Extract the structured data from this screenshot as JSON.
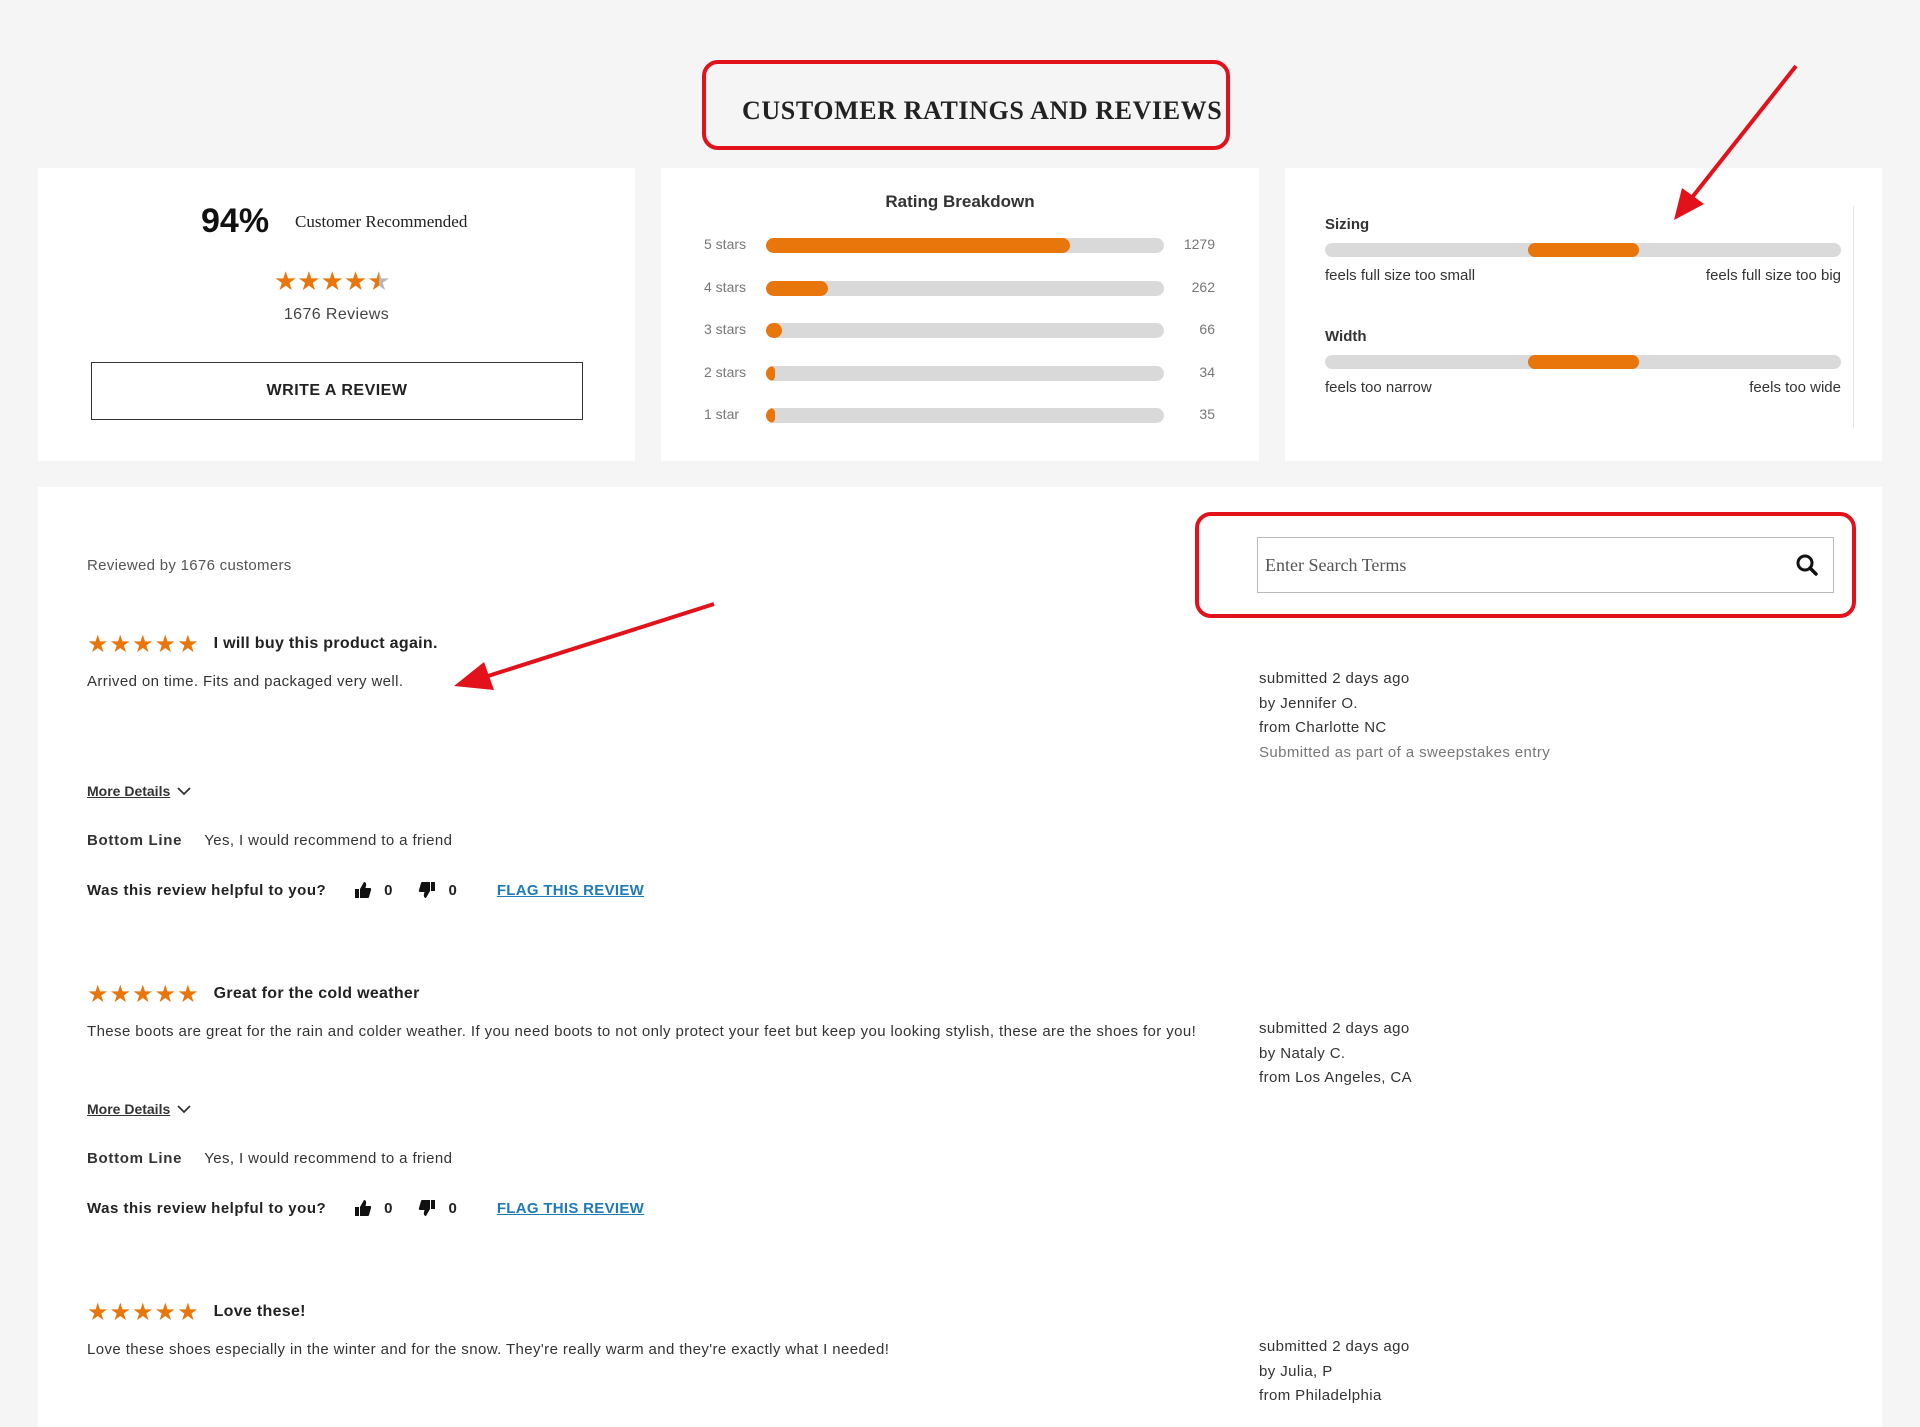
{
  "header": {
    "title": "CUSTOMER RATINGS AND REVIEWS"
  },
  "summary": {
    "recommend_percent": "94%",
    "recommend_label": "Customer Recommended",
    "stars": "★★★★",
    "half_star": "★",
    "average_rating": 4.5,
    "reviews_count_label": "1676 Reviews",
    "write_review_label": "WRITE A REVIEW"
  },
  "breakdown": {
    "title": "Rating Breakdown",
    "rows": [
      {
        "label": "5 stars",
        "count": "1279",
        "fraction": 0.763
      },
      {
        "label": "4 stars",
        "count": "262",
        "fraction": 0.156
      },
      {
        "label": "3 stars",
        "count": "66",
        "fraction": 0.039
      },
      {
        "label": "2 stars",
        "count": "34",
        "fraction": 0.02
      },
      {
        "label": "1 star",
        "count": "35",
        "fraction": 0.021
      }
    ]
  },
  "fit": {
    "sizing": {
      "title": "Sizing",
      "low_label": "feels full size too small",
      "high_label": "feels full size too big",
      "position": 0.5
    },
    "width": {
      "title": "Width",
      "low_label": "feels too narrow",
      "high_label": "feels too wide",
      "position": 0.5
    }
  },
  "reviews_panel": {
    "reviewed_by": "Reviewed by 1676 customers",
    "search_placeholder": "Enter Search Terms",
    "more_details_label": "More Details",
    "bottom_line_label": "Bottom Line",
    "helpful_question": "Was this review helpful to you?",
    "flag_label": "FLAG THIS REVIEW",
    "reviews": [
      {
        "stars": "★★★★★",
        "title": "I will buy this product again.",
        "body": "Arrived on time. Fits and packaged very well.",
        "submitted": "submitted 2 days ago",
        "author": "by Jennifer O.",
        "location": "from Charlotte NC",
        "note": "Submitted as part of a sweepstakes entry",
        "bottom_line": "Yes, I would recommend to a friend",
        "helpful_yes": "0",
        "helpful_no": "0"
      },
      {
        "stars": "★★★★★",
        "title": "Great for the cold weather",
        "body": "These boots are great for the rain and colder weather. If you need boots to not only protect your feet but keep you looking stylish, these are the shoes for you!",
        "submitted": "submitted 2 days ago",
        "author": "by Nataly C.",
        "location": "from Los Angeles, CA",
        "bottom_line": "Yes, I would recommend to a friend",
        "helpful_yes": "0",
        "helpful_no": "0"
      },
      {
        "stars": "★★★★★",
        "title": "Love these!",
        "body": "Love these shoes especially in the winter and for the snow. They're really warm and they're exactly what I needed!",
        "submitted": "submitted 2 days ago",
        "author": "by Julia, P",
        "location": "from Philadelphia"
      }
    ]
  },
  "colors": {
    "accent": "#e8760b",
    "annotation": "#e3121a",
    "link": "#1f7ab8"
  }
}
